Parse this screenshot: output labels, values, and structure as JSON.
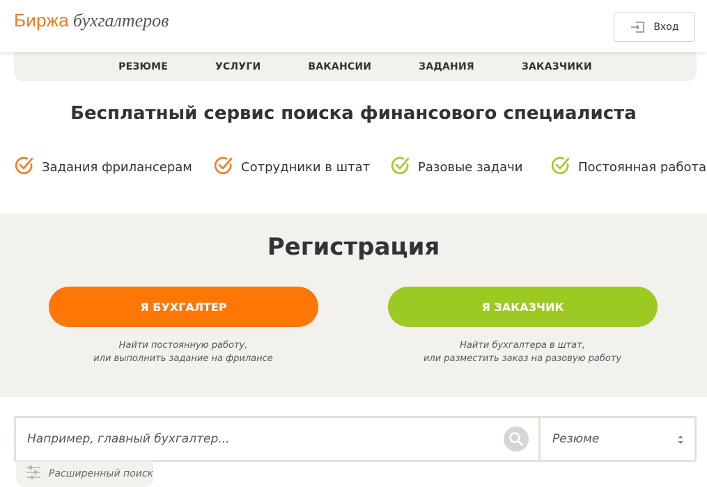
{
  "header": {
    "logo_main": "Биржа",
    "logo_sub": "бухгалтеров",
    "login_label": "Вход"
  },
  "nav": {
    "items": [
      "Резюме",
      "Услуги",
      "Вакансии",
      "Задания",
      "Заказчики"
    ]
  },
  "tagline": "Бесплатный сервис поиска финансового специалиста",
  "features": [
    {
      "label": "Задания фрилансерам",
      "color": "#f07a1e"
    },
    {
      "label": "Сотрудники в штат",
      "color": "#f07a1e"
    },
    {
      "label": "Разовые задачи",
      "color": "#9cc925"
    },
    {
      "label": "Постоянная работа",
      "color": "#9cc925"
    }
  ],
  "registration": {
    "title": "Регистрация",
    "accountant": {
      "label": "Я бухгалтер",
      "note_line1": "Найти постоянную работу,",
      "note_line2": "или выполнить задание на фрилансе",
      "color": "#fd7707"
    },
    "customer": {
      "label": "Я заказчик",
      "note_line1": "Найти бухгалтера в штат,",
      "note_line2": "или разместить заказ на разовую работу",
      "color": "#9dc923"
    }
  },
  "search": {
    "placeholder": "Например, главный бухгалтер...",
    "select_value": "Резюме",
    "advanced_label": "Расширенный поиск",
    "icon": "search-icon"
  },
  "colors": {
    "brand_orange": "#f07a1e",
    "brand_green": "#9cc925",
    "panel_bg": "#f2f1ee"
  }
}
